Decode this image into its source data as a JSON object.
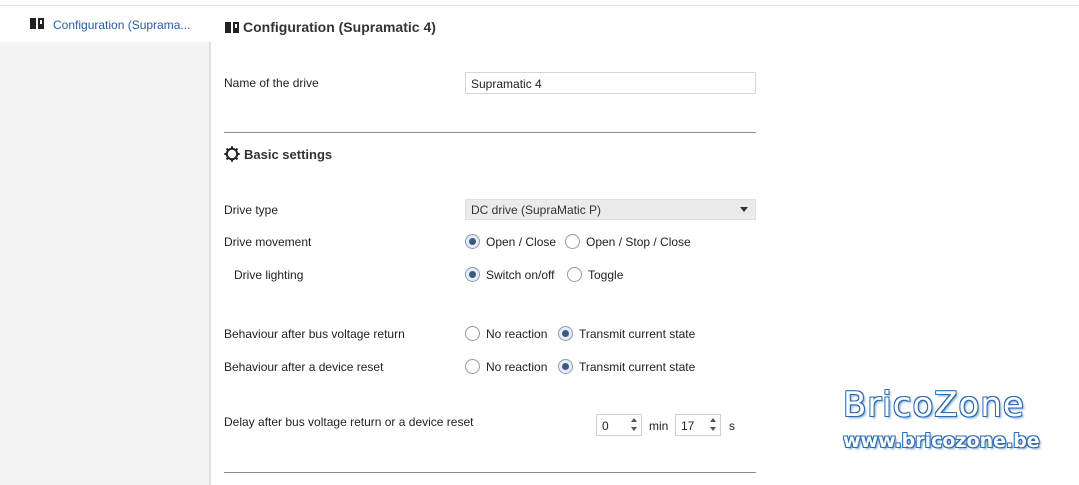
{
  "sidebar": {
    "item_label": "Configuration (Suprama..."
  },
  "main": {
    "title": "Configuration (Supramatic 4)"
  },
  "drive_name": {
    "label": "Name of the drive",
    "value": "Supramatic 4"
  },
  "basic": {
    "title": "Basic settings",
    "drive_type": {
      "label": "Drive type",
      "value": "DC drive (SupraMatic P)"
    },
    "drive_movement": {
      "label": "Drive movement",
      "opt1": "Open / Close",
      "opt2": "Open / Stop / Close",
      "selected": "Open / Close"
    },
    "drive_lighting": {
      "label": "Drive lighting",
      "opt1": "Switch on/off",
      "opt2": "Toggle",
      "selected": "Switch on/off"
    },
    "bus_return": {
      "label": "Behaviour after bus voltage return",
      "opt1": "No reaction",
      "opt2": "Transmit current state",
      "selected": "Transmit current state"
    },
    "device_reset": {
      "label": "Behaviour after a device reset",
      "opt1": "No reaction",
      "opt2": "Transmit current state",
      "selected": "Transmit current state"
    },
    "delay": {
      "label": "Delay after bus voltage return or a device reset",
      "minutes": "0",
      "min_unit": "min",
      "seconds": "17",
      "sec_unit": "s"
    }
  },
  "watermark": {
    "line1": "BricoZone",
    "line2": "www.bricozone.be"
  },
  "colors": {
    "link": "#1f5fa6",
    "radio_dot": "#3e5a7f",
    "watermark": "#2d6bb0"
  }
}
